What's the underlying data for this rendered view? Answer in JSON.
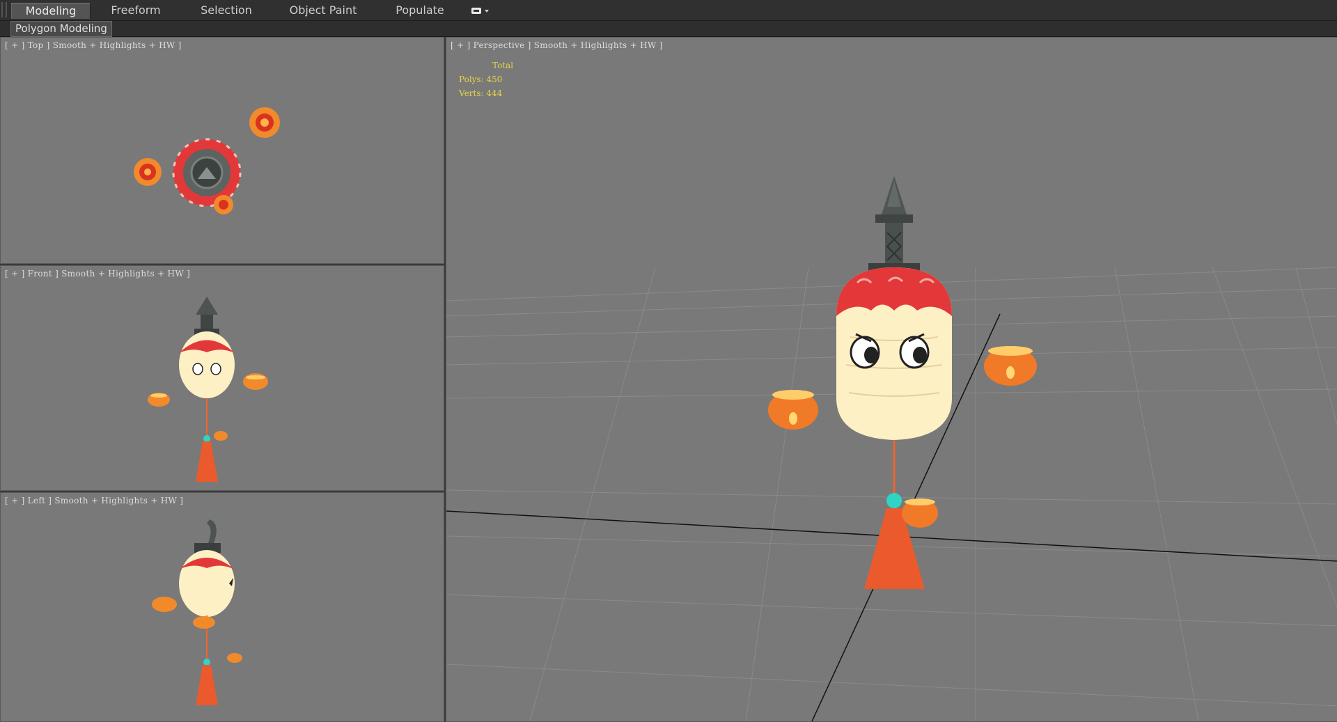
{
  "ribbon": {
    "tabs": [
      {
        "label": "Modeling",
        "active": true
      },
      {
        "label": "Freeform",
        "active": false
      },
      {
        "label": "Selection",
        "active": false
      },
      {
        "label": "Object Paint",
        "active": false
      },
      {
        "label": "Populate",
        "active": false
      }
    ],
    "extra_icon": "toggle-ribbon-dropdown-icon"
  },
  "subribbon": {
    "panel_label": "Polygon Modeling"
  },
  "viewports": {
    "top": {
      "label": "[ + ] Top ] Smooth + Highlights + HW ]"
    },
    "front": {
      "label": "[ + ] Front ] Smooth + Highlights + HW ]"
    },
    "left": {
      "label": "[ + ] Left ] Smooth + Highlights + HW ]"
    },
    "perspective": {
      "label": "[ + ] Perspective ] Smooth + Highlights + HW ]"
    }
  },
  "stats": {
    "header": "Total",
    "polys": "Polys: 450",
    "verts": "Verts: 444"
  },
  "colors": {
    "viewport_bg": "#797979",
    "ribbon_bg": "#303030",
    "stats_text": "#e6d34a",
    "lantern_red": "#e2383a",
    "lantern_cream": "#fdf0c4",
    "lamp_orange": "#f07a28",
    "bead_cyan": "#2fd4c4"
  }
}
